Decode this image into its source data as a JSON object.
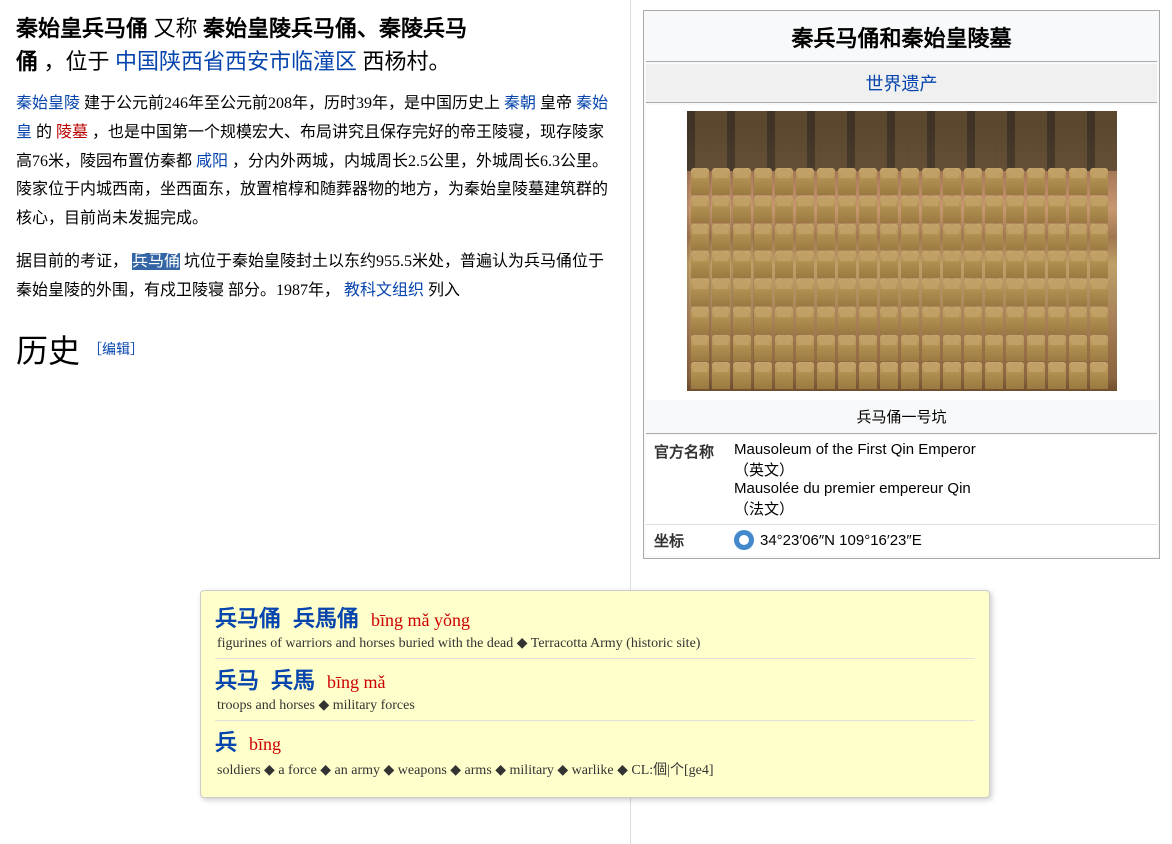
{
  "page": {
    "title": "秦兵马俑和秦始皇陵墓"
  },
  "left": {
    "article_title_part1": "秦始皇兵马俑",
    "article_title_bold": "又称",
    "article_title_part2_bold": "秦始皇陵兵马俑、秦陵兵马",
    "article_title_part3_bold": "俑",
    "article_title_rest": "，位于",
    "article_title_link": "中国陕西省西安市临潼区",
    "article_title_end": "西杨村。",
    "para1_link1": "秦始皇陵",
    "para1_text1": "建于公元前246年至公元前208年，历时39年，是中国历史上",
    "para1_link2": "秦朝",
    "para1_text2": "皇帝",
    "para1_link3": "秦始皇",
    "para1_text3": "的",
    "para1_link4": "陵墓",
    "para1_text4": "，也是中国第一个规模宏大、布局讲究且保存完好的帝王陵寝，现存陵家高76米，陵园布置仿秦都",
    "para1_link5": "咸阳",
    "para1_text5": "，分内外两城，内城周长2.5公里，外城周长6.3公里。陵家位于内城西南，坐西面东，放置棺椁和随葬器物的地方，为秦始皇陵墓建筑群的核心，目前尚未发掘完成。",
    "para2_text1": "据目前的考证，",
    "para2_selected": "兵马俑",
    "para2_text2": "坑位于秦始皇陵封土以东约955.5米处，普遍认为兵马俑位于秦始皇陵的外围，有戍卫陵寝",
    "para2_text3": "部分。1987年，",
    "para2_link1": "教科文组织",
    "para2_text4": "列入",
    "history_label": "历史",
    "history_edit": "［编辑］"
  },
  "tooltip": {
    "row1_hanzi_simp": "兵马俑",
    "row1_hanzi_trad": "兵馬俑",
    "row1_pinyin": "bīng mǎ yǒng",
    "row1_def": "figurines of warriors and horses buried with the dead ◆ Terracotta Army (historic site)",
    "row2_hanzi_simp": "兵马",
    "row2_hanzi_trad": "兵馬",
    "row2_pinyin": "bīng mǎ",
    "row2_def": "troops and horses ◆ military forces",
    "row3_hanzi_simp": "兵",
    "row3_pinyin": "bīng",
    "row3_def": "soldiers ◆ a force ◆ an army ◆ weapons ◆ arms ◆ military ◆ warlike ◆ CL:個|个[ge4]"
  },
  "right": {
    "infobox_title": "秦兵马俑和秦始皇陵墓",
    "infobox_subtitle": "世界遗产",
    "image_caption": "兵马俑一号坑",
    "official_name_label": "官方名称",
    "official_name_en": "Mausoleum of the First Qin Emperor",
    "official_name_en_note": "（英文）",
    "official_name_fr": "Mausolée du premier empereur Qin",
    "official_name_fr_note": "（法文）",
    "coord_label": "坐标",
    "coord_value": "34°23′06″N 109°16′23″E"
  }
}
